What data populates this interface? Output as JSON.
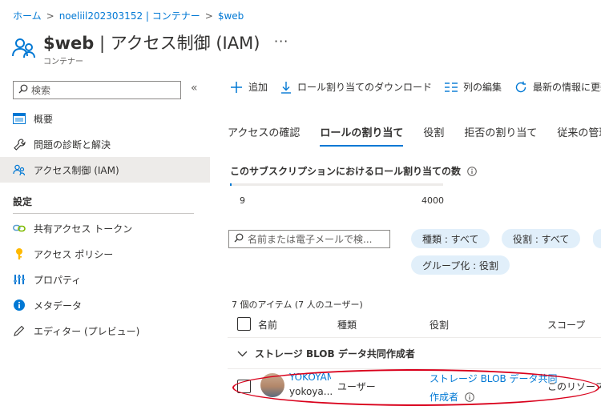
{
  "breadcrumb": {
    "items": [
      "ホーム",
      "noeliil202303152 | コンテナー",
      "$web"
    ],
    "sep": ">"
  },
  "header": {
    "title_bold": "$web",
    "title_rest": " | アクセス制御 (IAM)",
    "more": "···",
    "subtitle": "コンテナー"
  },
  "sidebar": {
    "search_placeholder": "検索",
    "collapse": "«",
    "items": [
      {
        "label": "概要",
        "icon": "overview-icon"
      },
      {
        "label": "問題の診断と解決",
        "icon": "wrench-icon"
      },
      {
        "label": "アクセス制御 (IAM)",
        "icon": "people-icon"
      }
    ],
    "section_label": "設定",
    "settings_items": [
      {
        "label": "共有アクセス トークン",
        "icon": "link-icon"
      },
      {
        "label": "アクセス ポリシー",
        "icon": "key-icon"
      },
      {
        "label": "プロパティ",
        "icon": "properties-icon"
      },
      {
        "label": "メタデータ",
        "icon": "info-icon"
      },
      {
        "label": "エディター (プレビュー)",
        "icon": "pencil-icon"
      }
    ]
  },
  "commands": {
    "add": "追加",
    "download": "ロール割り当てのダウンロード",
    "edit_columns": "列の編集",
    "refresh": "最新の情報に更新"
  },
  "tabs": [
    "アクセスの確認",
    "ロールの割り当て",
    "役割",
    "拒否の割り当て",
    "従来の管理者"
  ],
  "active_tab": "ロールの割り当て",
  "usage": {
    "title": "このサブスクリプションにおけるロール割り当ての数",
    "current": "9",
    "max": "4000",
    "fraction": 0.00225
  },
  "filters": {
    "search_placeholder": "名前または電子メールで検...",
    "pills": [
      "種類 : すべて",
      "役割 : すべて",
      "グループ化 : 役割"
    ]
  },
  "table": {
    "count_text": "7 個のアイテム (7 人のユーザー)",
    "headers": [
      "名前",
      "種類",
      "役割",
      "スコープ"
    ],
    "group": "ストレージ BLOB データ共同作成者",
    "rows": [
      {
        "name": "YOKOYAMA",
        "email": "yokoya...",
        "type": "ユーザー",
        "role_line1": "ストレージ BLOB データ共同",
        "role_line2": "作成者",
        "scope": "このリソース"
      }
    ]
  },
  "colors": {
    "accent": "#0078d4",
    "highlight_ellipse": "#d9001b",
    "pill_bg": "#e1effa"
  }
}
